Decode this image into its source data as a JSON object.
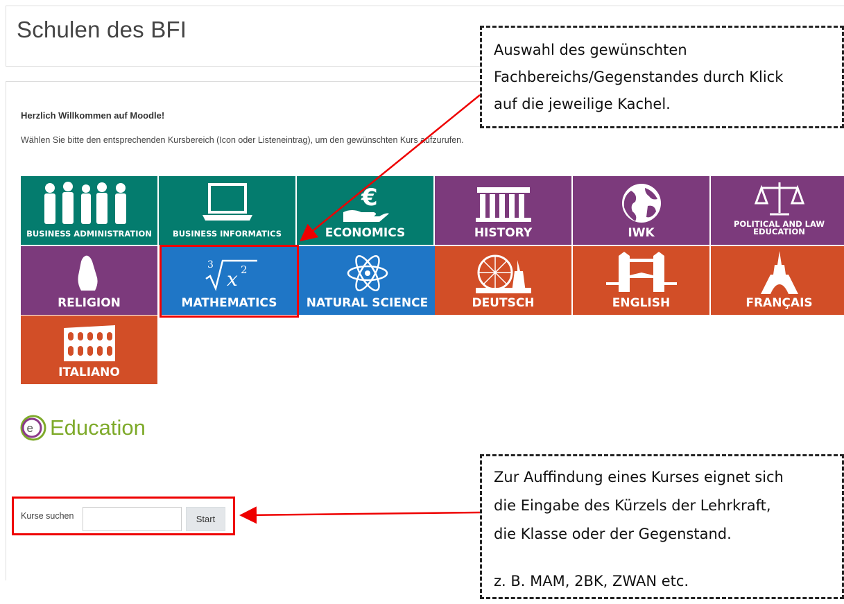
{
  "header": {
    "site_title": "Schulen des BFI"
  },
  "welcome": {
    "heading": "Herzlich Willkommen auf Moodle!",
    "text": "Wählen Sie bitte den entsprechenden Kursbereich (Icon oder Listeneintrag), um den gewünschten Kurs aufzurufen."
  },
  "tiles": [
    {
      "label": "BUSINESS ADMINISTRATION",
      "icon": "people-icon",
      "color": "#047c6e"
    },
    {
      "label": "BUSINESS INFORMATICS",
      "icon": "laptop-icon",
      "color": "#047c6e"
    },
    {
      "label": "ECONOMICS",
      "icon": "euro-hand-icon",
      "color": "#047c6e"
    },
    {
      "label": "HISTORY",
      "icon": "temple-icon",
      "color": "#7c3a7c"
    },
    {
      "label": "IWK",
      "icon": "globe-icon",
      "color": "#7c3a7c"
    },
    {
      "label": "POLITICAL AND LAW EDUCATION",
      "icon": "scales-icon",
      "color": "#7c3a7c"
    },
    {
      "label": "RELIGION",
      "icon": "praying-hands-icon",
      "color": "#7c3a7c"
    },
    {
      "label": "MATHEMATICS",
      "icon": "cube-root-icon",
      "color": "#1f76c6"
    },
    {
      "label": "NATURAL SCIENCE",
      "icon": "atom-icon",
      "color": "#1f76c6"
    },
    {
      "label": "DEUTSCH",
      "icon": "vienna-landmarks-icon",
      "color": "#d24e27"
    },
    {
      "label": "ENGLISH",
      "icon": "tower-bridge-icon",
      "color": "#d24e27"
    },
    {
      "label": "FRANÇAIS",
      "icon": "eiffel-tower-icon",
      "color": "#d24e27"
    },
    {
      "label": "ITALIANO",
      "icon": "colosseum-icon",
      "color": "#d24e27"
    }
  ],
  "math_formula": {
    "index": "3",
    "base": "x",
    "exp": "2"
  },
  "brand": {
    "mark": "e",
    "text": "Education"
  },
  "search": {
    "label": "Kurse suchen",
    "button": "Start",
    "value": ""
  },
  "callouts": {
    "top": [
      "Auswahl des gewünschten",
      "Fachbereichs/Gegenstandes durch Klick",
      "auf die jeweilige Kachel."
    ],
    "bottom": [
      "Zur Auffindung eines Kurses eignet sich",
      "die Eingabe des Kürzels der Lehrkraft,",
      "die Klasse oder der Gegenstand."
    ],
    "bottom_example": "z. B. MAM, 2BK, ZWAN etc."
  },
  "annotation_color": "#e00000"
}
